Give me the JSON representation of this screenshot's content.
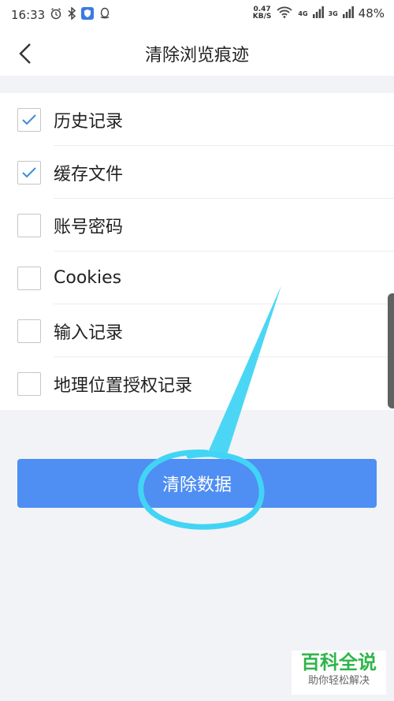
{
  "status_bar": {
    "time": "16:33",
    "speed_value": "0.47",
    "speed_unit": "KB/S",
    "net1": "4G",
    "net2": "3G",
    "battery": "48%"
  },
  "header": {
    "title": "清除浏览痕迹",
    "back_icon": "chevron-left-icon"
  },
  "options": [
    {
      "label": "历史记录",
      "checked": true
    },
    {
      "label": "缓存文件",
      "checked": true
    },
    {
      "label": "账号密码",
      "checked": false
    },
    {
      "label": "Cookies",
      "checked": false
    },
    {
      "label": "输入记录",
      "checked": false
    },
    {
      "label": "地理位置授权记录",
      "checked": false
    }
  ],
  "clear_button": {
    "label": "清除数据"
  },
  "watermark": {
    "title": "百科全说",
    "subtitle": "助你轻松解决"
  },
  "colors": {
    "accent": "#4f8ef3",
    "check": "#3b8bd8",
    "annotation": "#42d4f4",
    "watermark": "#2fb54a"
  }
}
